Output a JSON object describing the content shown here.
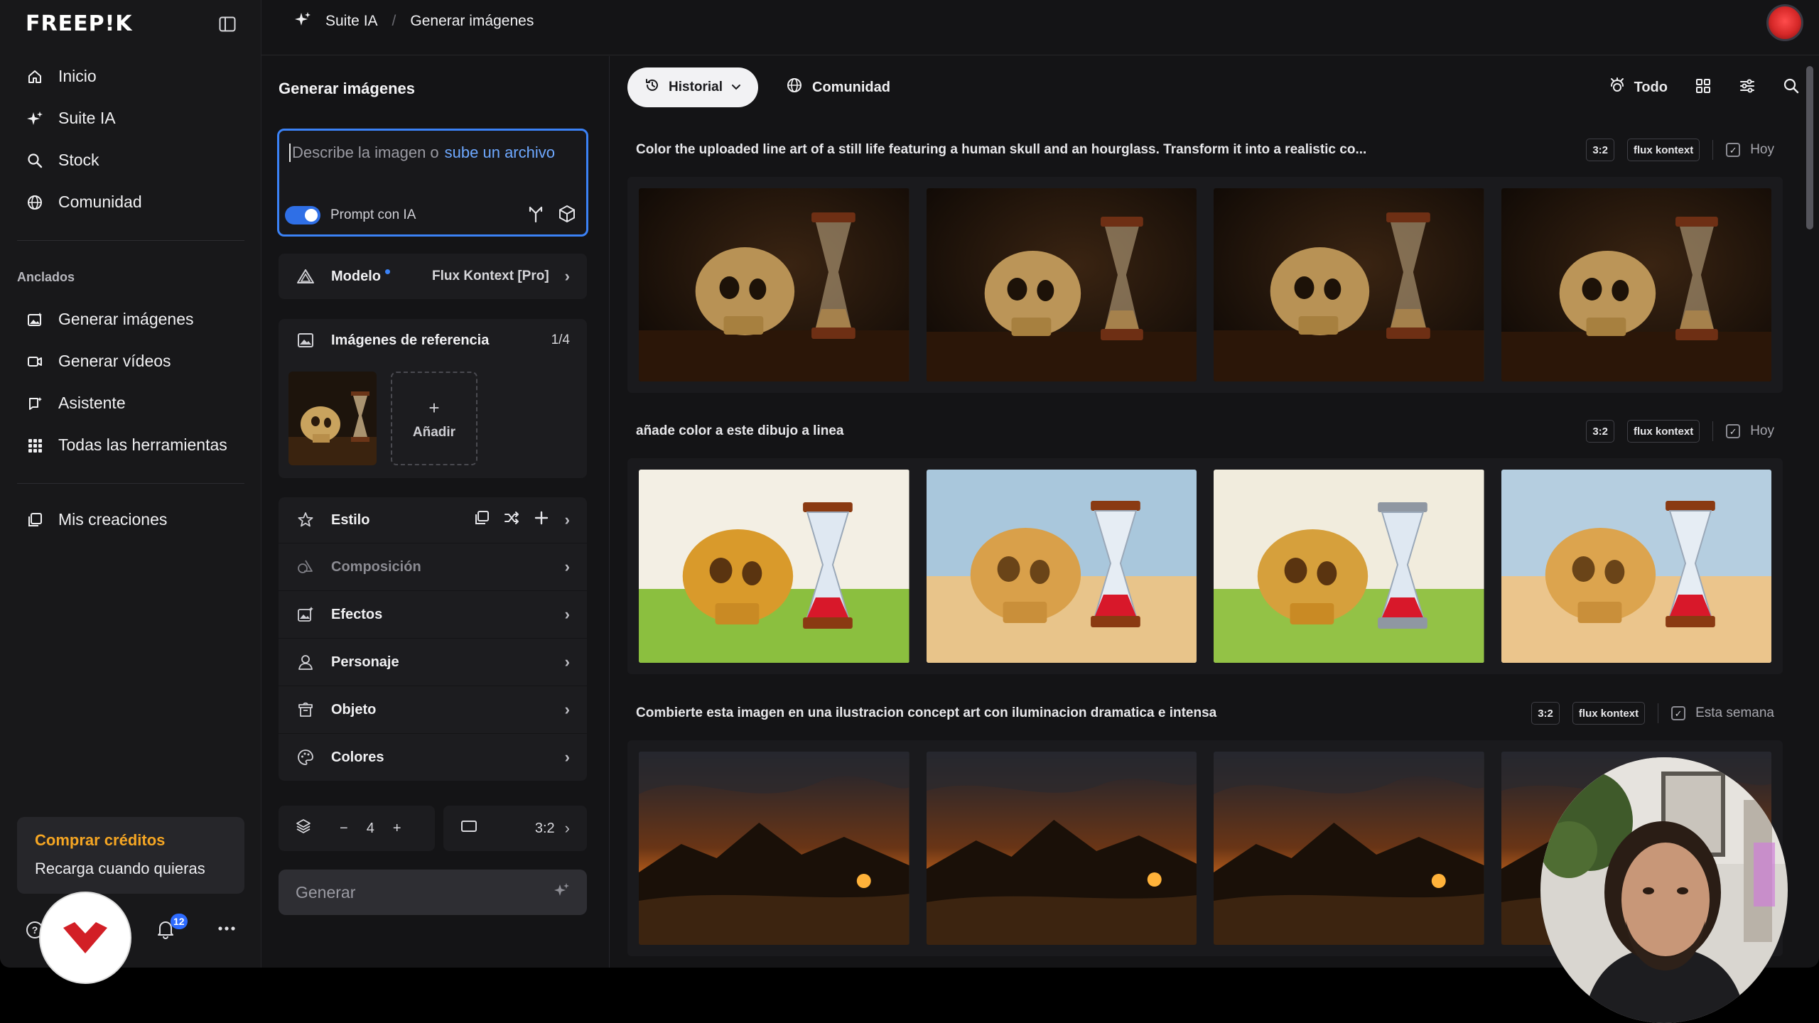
{
  "app": {
    "brand": "FREEP!K"
  },
  "sidebar": {
    "nav": [
      {
        "label": "Inicio",
        "icon": "home-icon"
      },
      {
        "label": "Suite IA",
        "icon": "sparkle-icon"
      },
      {
        "label": "Stock",
        "icon": "search-icon"
      },
      {
        "label": "Comunidad",
        "icon": "globe-icon"
      }
    ],
    "pinned_title": "Anclados",
    "pinned": [
      {
        "label": "Generar imágenes",
        "icon": "image-gen-icon"
      },
      {
        "label": "Generar vídeos",
        "icon": "video-icon"
      },
      {
        "label": "Asistente",
        "icon": "chat-icon"
      },
      {
        "label": "Todas las herramientas",
        "icon": "grid-icon"
      }
    ],
    "my_creations": "Mis creaciones",
    "credits": {
      "title": "Comprar créditos",
      "subtitle": "Recarga cuando quieras"
    },
    "notifications_count": "12"
  },
  "topbar": {
    "breadcrumb": {
      "parent": "Suite IA",
      "separator": "/",
      "current": "Generar imágenes"
    }
  },
  "panel": {
    "title": "Generar imágenes",
    "prompt": {
      "placeholder": "Describe la imagen o",
      "upload_link": "sube un archivo",
      "ai_prompt_label": "Prompt con IA",
      "ai_prompt_enabled": true
    },
    "model": {
      "label": "Modelo",
      "value": "Flux Kontext [Pro]"
    },
    "reference": {
      "label": "Imágenes de referencia",
      "count": "1/4",
      "add_label": "Añadir",
      "add_symbol": "+"
    },
    "settings": [
      {
        "label": "Estilo",
        "icon": "style-icon"
      },
      {
        "label": "Composición",
        "icon": "composition-icon",
        "disabled": true
      },
      {
        "label": "Efectos",
        "icon": "effects-icon"
      },
      {
        "label": "Personaje",
        "icon": "person-icon"
      },
      {
        "label": "Objeto",
        "icon": "object-icon"
      },
      {
        "label": "Colores",
        "icon": "palette-icon"
      }
    ],
    "quantity": {
      "minus": "−",
      "value": "4",
      "plus": "+"
    },
    "aspect_ratio": "3:2",
    "generate_label": "Generar"
  },
  "feed": {
    "history_label": "Historial",
    "community_label": "Comunidad",
    "filter_label": "Todo",
    "groups": [
      {
        "prompt": "Color the uploaded line art of a still life featuring a human skull and an hourglass. Transform it into a realistic co...",
        "ratio": "3:2",
        "model": "flux kontext",
        "when": "Hoy",
        "theme": "dark-still-life"
      },
      {
        "prompt": "añade color a este dibujo a linea",
        "ratio": "3:2",
        "model": "flux kontext",
        "when": "Hoy",
        "theme": "watercolor-still-life"
      },
      {
        "prompt": "Combierte esta imagen en una ilustracion concept art con iluminacion dramatica e intensa",
        "ratio": "3:2",
        "model": "flux kontext",
        "when": "Esta semana",
        "theme": "sunset-landscape"
      }
    ]
  },
  "colors": {
    "accent": "#3b82f6",
    "credits": "#f5a623",
    "panel_bg": "#1c1c1f",
    "app_bg": "#141416"
  }
}
